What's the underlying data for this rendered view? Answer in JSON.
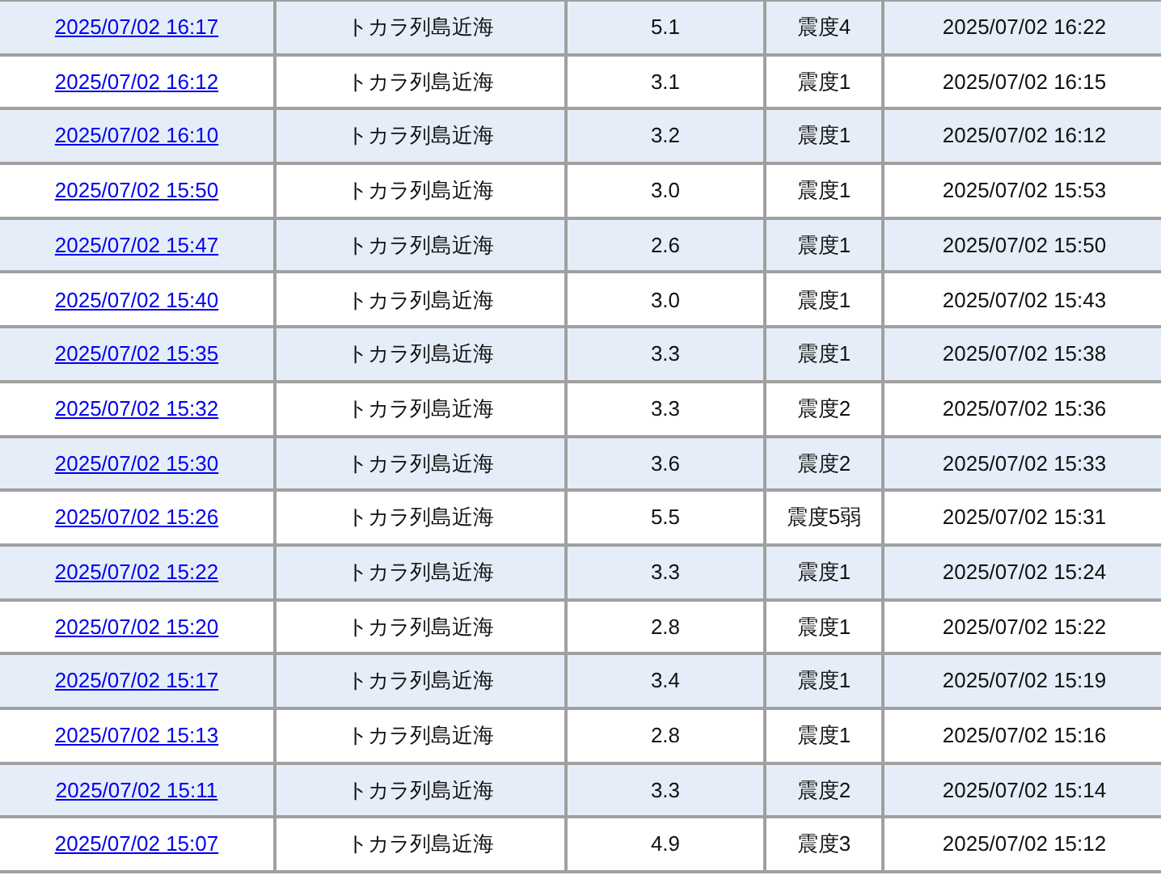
{
  "table": {
    "rows": [
      {
        "detected_at": "2025/07/02 16:17",
        "region": "トカラ列島近海",
        "magnitude": "5.1",
        "intensity": "震度4",
        "announced_at": "2025/07/02 16:22"
      },
      {
        "detected_at": "2025/07/02 16:12",
        "region": "トカラ列島近海",
        "magnitude": "3.1",
        "intensity": "震度1",
        "announced_at": "2025/07/02 16:15"
      },
      {
        "detected_at": "2025/07/02 16:10",
        "region": "トカラ列島近海",
        "magnitude": "3.2",
        "intensity": "震度1",
        "announced_at": "2025/07/02 16:12"
      },
      {
        "detected_at": "2025/07/02 15:50",
        "region": "トカラ列島近海",
        "magnitude": "3.0",
        "intensity": "震度1",
        "announced_at": "2025/07/02 15:53"
      },
      {
        "detected_at": "2025/07/02 15:47",
        "region": "トカラ列島近海",
        "magnitude": "2.6",
        "intensity": "震度1",
        "announced_at": "2025/07/02 15:50"
      },
      {
        "detected_at": "2025/07/02 15:40",
        "region": "トカラ列島近海",
        "magnitude": "3.0",
        "intensity": "震度1",
        "announced_at": "2025/07/02 15:43"
      },
      {
        "detected_at": "2025/07/02 15:35",
        "region": "トカラ列島近海",
        "magnitude": "3.3",
        "intensity": "震度1",
        "announced_at": "2025/07/02 15:38"
      },
      {
        "detected_at": "2025/07/02 15:32",
        "region": "トカラ列島近海",
        "magnitude": "3.3",
        "intensity": "震度2",
        "announced_at": "2025/07/02 15:36"
      },
      {
        "detected_at": "2025/07/02 15:30",
        "region": "トカラ列島近海",
        "magnitude": "3.6",
        "intensity": "震度2",
        "announced_at": "2025/07/02 15:33"
      },
      {
        "detected_at": "2025/07/02 15:26",
        "region": "トカラ列島近海",
        "magnitude": "5.5",
        "intensity": "震度5弱",
        "announced_at": "2025/07/02 15:31"
      },
      {
        "detected_at": "2025/07/02 15:22",
        "region": "トカラ列島近海",
        "magnitude": "3.3",
        "intensity": "震度1",
        "announced_at": "2025/07/02 15:24"
      },
      {
        "detected_at": "2025/07/02 15:20",
        "region": "トカラ列島近海",
        "magnitude": "2.8",
        "intensity": "震度1",
        "announced_at": "2025/07/02 15:22"
      },
      {
        "detected_at": "2025/07/02 15:17",
        "region": "トカラ列島近海",
        "magnitude": "3.4",
        "intensity": "震度1",
        "announced_at": "2025/07/02 15:19"
      },
      {
        "detected_at": "2025/07/02 15:13",
        "region": "トカラ列島近海",
        "magnitude": "2.8",
        "intensity": "震度1",
        "announced_at": "2025/07/02 15:16"
      },
      {
        "detected_at": "2025/07/02 15:11",
        "region": "トカラ列島近海",
        "magnitude": "3.3",
        "intensity": "震度2",
        "announced_at": "2025/07/02 15:14"
      },
      {
        "detected_at": "2025/07/02 15:07",
        "region": "トカラ列島近海",
        "magnitude": "4.9",
        "intensity": "震度3",
        "announced_at": "2025/07/02 15:12"
      }
    ]
  }
}
